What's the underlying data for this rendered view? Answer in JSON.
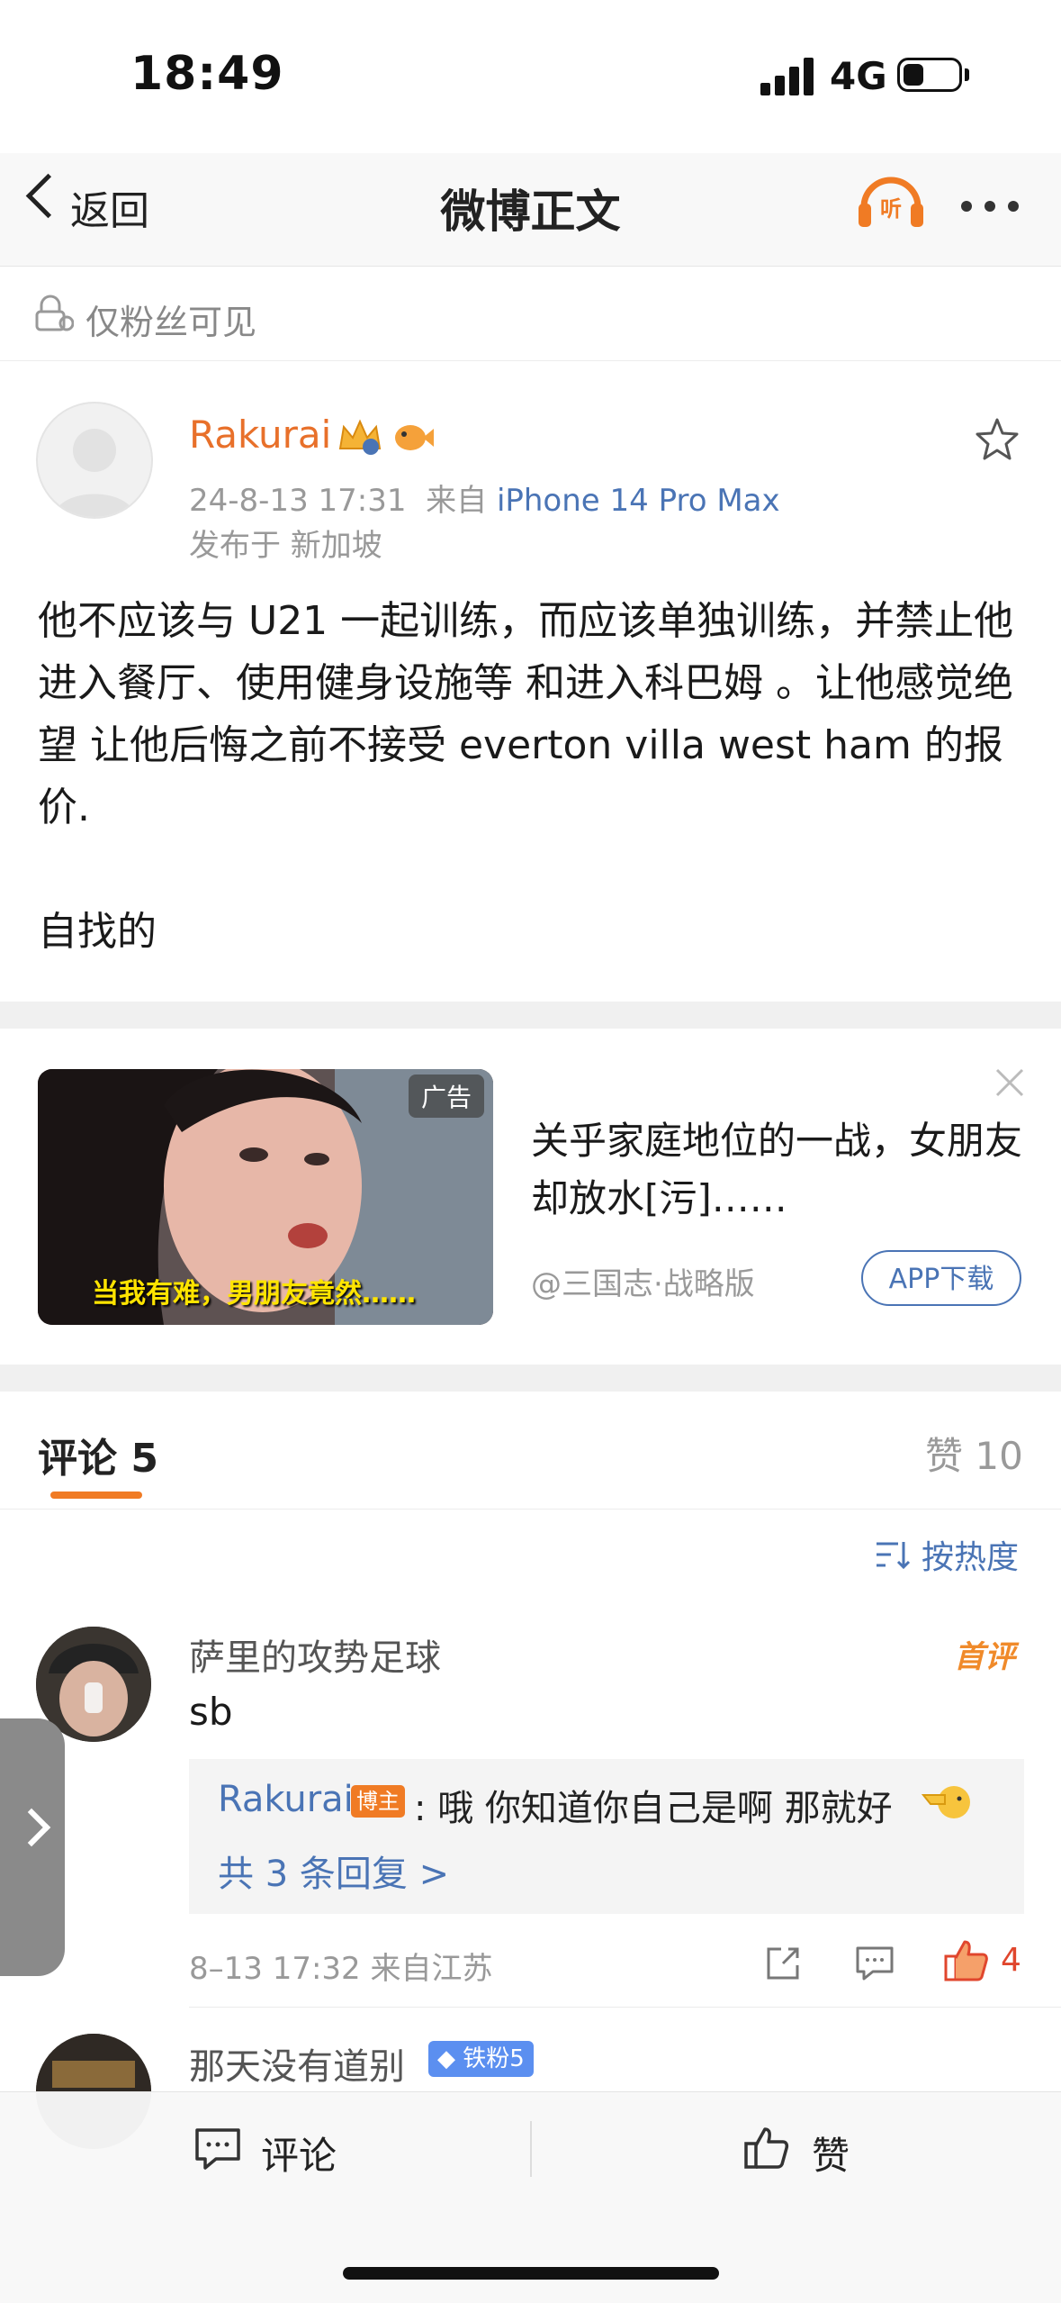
{
  "status_bar": {
    "time": "18:49",
    "network": "4G"
  },
  "nav": {
    "back_label": "返回",
    "title": "微博正文",
    "listen_icon": "听"
  },
  "visibility": {
    "label": "仅粉丝可见"
  },
  "post": {
    "author": "Rakurai",
    "timestamp": "24-8-13 17:31",
    "source_prefix": "来自",
    "device": "iPhone 14 Pro Max",
    "location": "发布于 新加坡",
    "body": "他不应该与 U21 一起训练，而应该单独训练，并禁止他进入餐厅、使用健身设施等 和进入科巴姆 。让他感觉绝望 让他后悔之前不接受 everton villa west ham 的报价.\n\n自找的"
  },
  "ad": {
    "tag": "广告",
    "image_caption": "当我有难，男朋友竟然……",
    "title": "关乎家庭地位的一战，女朋友却放水[污]……",
    "source": "@三国志·战略版",
    "button": "APP下载"
  },
  "comments_header": {
    "tab_label": "评论 5",
    "likes_label": "赞 10",
    "sort_label": "按热度"
  },
  "comments": [
    {
      "name": "萨里的攻势足球",
      "badge": "首评",
      "text": "sb",
      "reply": {
        "author": "Rakurai",
        "author_badge": "博主",
        "text": ": 哦 你知道你自己是啊 那就好",
        "more": "共 3 条回复 >"
      },
      "meta": "8–13 17:32  来自江苏",
      "likes": "4"
    },
    {
      "name": "那天没有道别",
      "fan_badge": "铁粉5"
    }
  ],
  "bottom_bar": {
    "comment_label": "评论",
    "like_label": "赞"
  },
  "colors": {
    "accent_orange": "#f07b24",
    "link_blue": "#4a74b5",
    "like_red": "#e0462d"
  }
}
